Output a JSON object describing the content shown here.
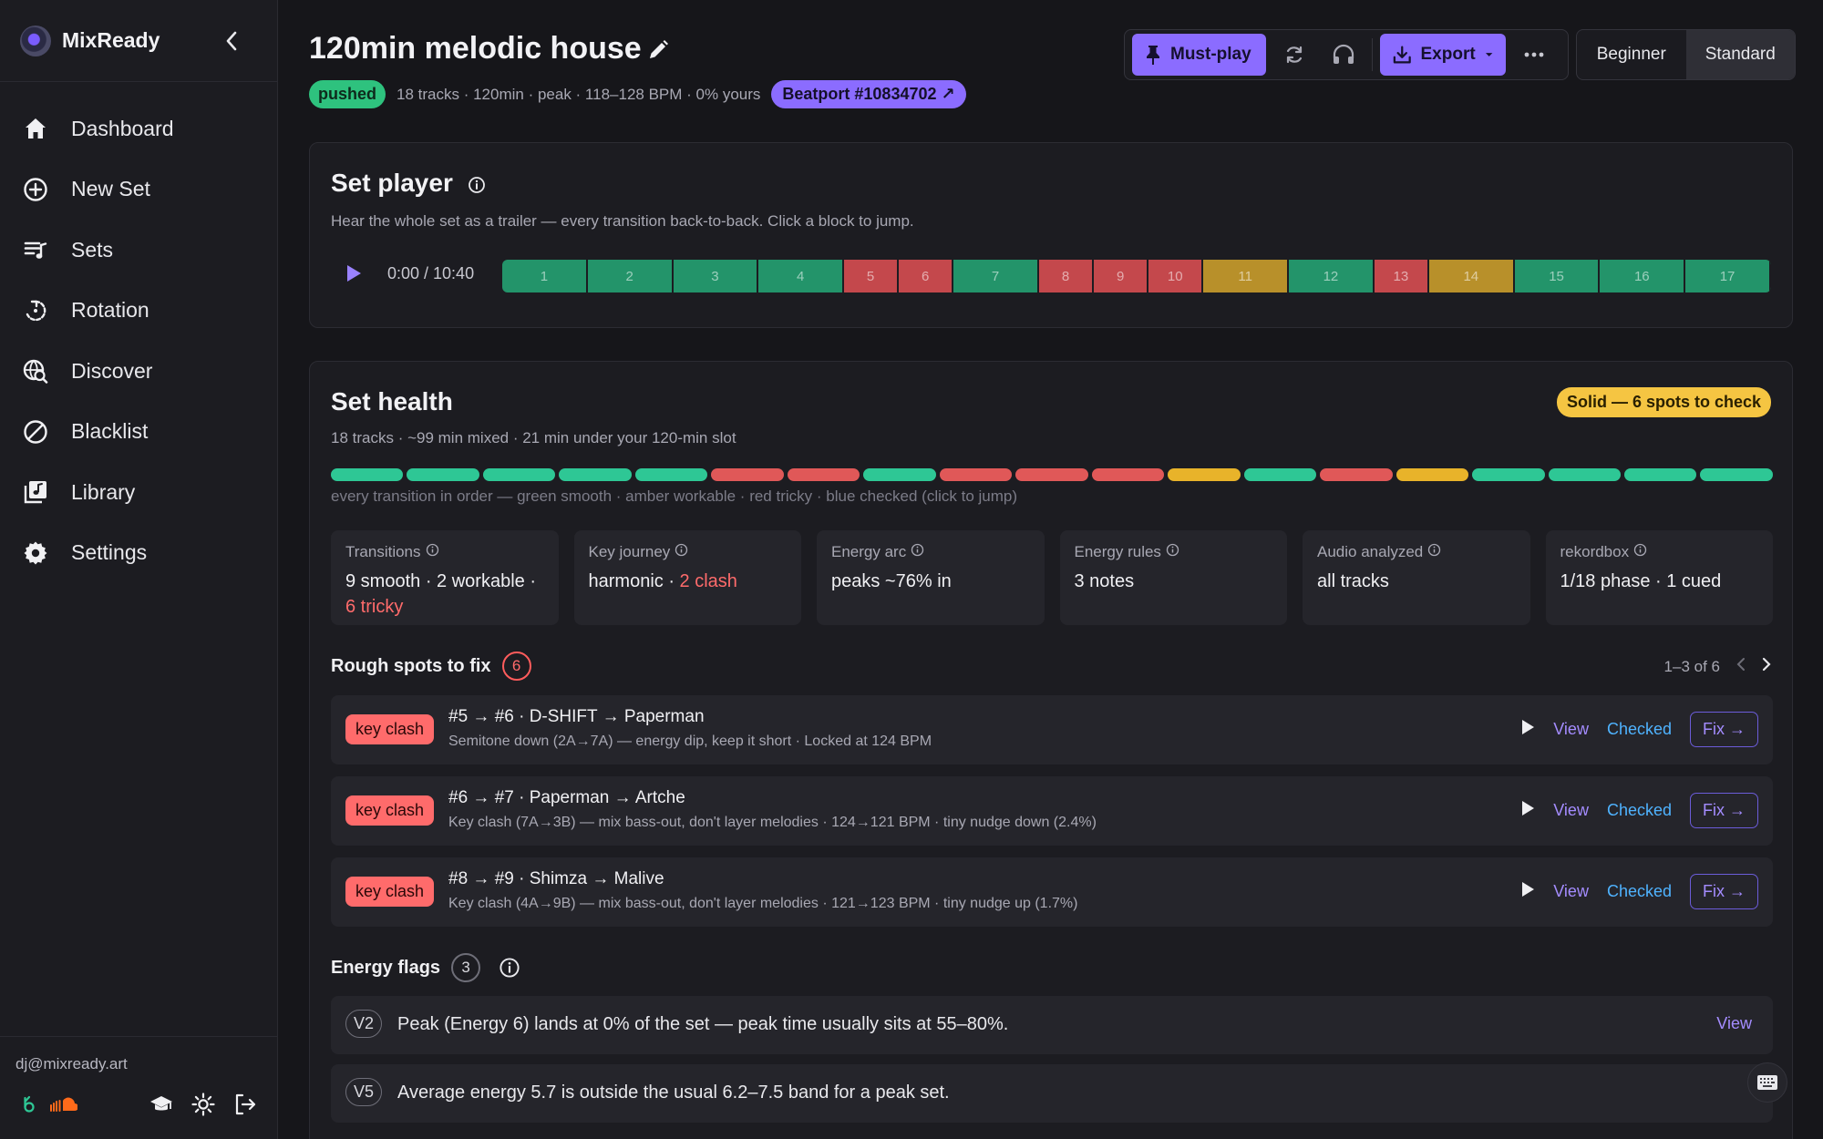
{
  "app": {
    "name": "MixReady"
  },
  "sidebar": {
    "items": [
      {
        "label": "Dashboard",
        "icon": "home-icon"
      },
      {
        "label": "New Set",
        "icon": "plus-circle-icon"
      },
      {
        "label": "Sets",
        "icon": "playlist-icon"
      },
      {
        "label": "Rotation",
        "icon": "rotation-icon"
      },
      {
        "label": "Discover",
        "icon": "discover-icon"
      },
      {
        "label": "Blacklist",
        "icon": "block-icon"
      },
      {
        "label": "Library",
        "icon": "library-icon"
      },
      {
        "label": "Settings",
        "icon": "gear-icon"
      }
    ],
    "user_email": "dj@mixready.art"
  },
  "header": {
    "title": "120min melodic house",
    "status_badge": "pushed",
    "meta": "18 tracks · 120min · peak · 118–128 BPM · 0% yours",
    "beatport_link": "Beatport #10834702 ↗"
  },
  "toolbar": {
    "must_play_label": "Must-play",
    "export_label": "Export",
    "mode_options": [
      "Beginner",
      "Standard"
    ],
    "active_mode": "Standard"
  },
  "player": {
    "title": "Set player",
    "subtitle": "Hear the whole set as a trailer — every transition back-to-back. Click a block to jump.",
    "time": "0:00 / 10:40",
    "blocks": [
      {
        "label": "1",
        "status": "green",
        "weight": 1.5
      },
      {
        "label": "2",
        "status": "green",
        "weight": 1.5
      },
      {
        "label": "3",
        "status": "green",
        "weight": 1.5
      },
      {
        "label": "4",
        "status": "green",
        "weight": 1.5
      },
      {
        "label": "5",
        "status": "red",
        "weight": 0.95
      },
      {
        "label": "6",
        "status": "red",
        "weight": 0.95
      },
      {
        "label": "7",
        "status": "green",
        "weight": 1.5
      },
      {
        "label": "8",
        "status": "red",
        "weight": 0.95
      },
      {
        "label": "9",
        "status": "red",
        "weight": 0.95
      },
      {
        "label": "10",
        "status": "red",
        "weight": 0.95
      },
      {
        "label": "11",
        "status": "amber",
        "weight": 1.5
      },
      {
        "label": "12",
        "status": "green",
        "weight": 1.5
      },
      {
        "label": "13",
        "status": "red",
        "weight": 0.95
      },
      {
        "label": "14",
        "status": "amber",
        "weight": 1.5
      },
      {
        "label": "15",
        "status": "green",
        "weight": 1.5
      },
      {
        "label": "16",
        "status": "green",
        "weight": 1.5
      },
      {
        "label": "17",
        "status": "green",
        "weight": 1.5
      }
    ]
  },
  "health": {
    "title": "Set health",
    "summary_badge": "Solid — 6 spots to check",
    "subtitle": "18 tracks · ~99 min mixed · 21 min under your 120-min slot",
    "transitions": [
      "green",
      "green",
      "green",
      "green",
      "green",
      "red",
      "red",
      "green",
      "red",
      "red",
      "red",
      "amber",
      "green",
      "red",
      "amber",
      "green",
      "green",
      "green",
      "green"
    ],
    "legend": "every transition in order — green smooth · amber workable · red tricky · blue checked (click to jump)",
    "tiles": [
      {
        "label": "Transitions",
        "value": "9 smooth · 2 workable · ",
        "value_red": "6 tricky"
      },
      {
        "label": "Key journey",
        "value": "harmonic · ",
        "value_red": "2 clash"
      },
      {
        "label": "Energy arc",
        "value": "peaks ~76% in",
        "value_red": ""
      },
      {
        "label": "Energy rules",
        "value": "3 notes",
        "value_red": ""
      },
      {
        "label": "Audio analyzed",
        "value": "all tracks",
        "value_red": ""
      },
      {
        "label": "rekordbox",
        "value": "1/18 phase · 1 cued",
        "value_red": ""
      }
    ],
    "rough_spots": {
      "title": "Rough spots to fix",
      "count": "6",
      "pager": "1–3 of 6",
      "items": [
        {
          "badge": "key clash",
          "title": "#5 → #6 · D-SHIFT → Paperman",
          "detail": "Semitone down (2A→7A) — energy dip, keep it short · Locked at 124 BPM"
        },
        {
          "badge": "key clash",
          "title": "#6 → #7 · Paperman → Artche",
          "detail": "Key clash (7A→3B) — mix bass-out, don't layer melodies · 124→121 BPM · tiny nudge down (2.4%)"
        },
        {
          "badge": "key clash",
          "title": "#8 → #9 · Shimza → Malive",
          "detail": "Key clash (4A→9B) — mix bass-out, don't layer melodies · 121→123 BPM · tiny nudge up (1.7%)"
        }
      ],
      "view_label": "View",
      "checked_label": "Checked",
      "fix_label": "Fix →"
    },
    "energy_flags": {
      "title": "Energy flags",
      "count": "3",
      "items": [
        {
          "code": "V2",
          "text": "Peak (Energy 6) lands at 0% of the set — peak time usually sits at 55–80%.",
          "action": "View"
        },
        {
          "code": "V5",
          "text": "Average energy 5.7 is outside the usual 6.2–7.5 band for a peak set.",
          "action": ""
        }
      ]
    }
  },
  "colors": {
    "green": "#23946a",
    "red": "#c4484c",
    "amber": "#b8902a",
    "accent": "#8b6cff",
    "seg_green": "#2ec795",
    "seg_red": "#e05858",
    "seg_amber": "#e8b32a"
  }
}
